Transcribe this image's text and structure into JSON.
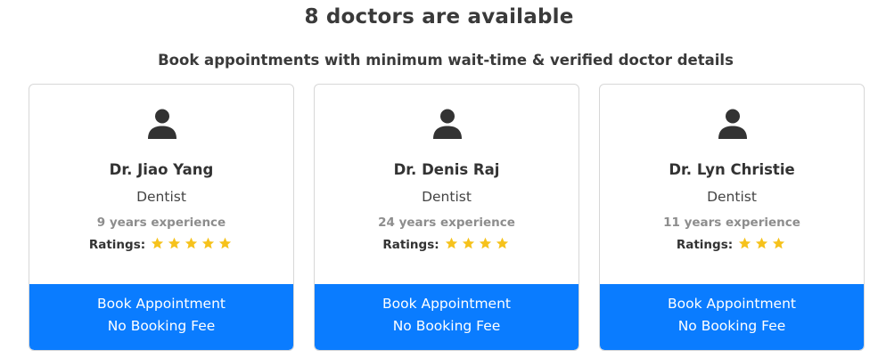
{
  "header": {
    "title": "8 doctors are available",
    "subtitle": "Book appointments with minimum wait-time & verified doctor details"
  },
  "colors": {
    "button": "#0a7cff",
    "star": "#f6c21c",
    "avatar": "#333333"
  },
  "doctors": [
    {
      "name": "Dr. Jiao Yang",
      "specialty": "Dentist",
      "experience": "9 years experience",
      "ratings_label": "Ratings:",
      "rating": 5,
      "button_line1": "Book Appointment",
      "button_line2": "No Booking Fee"
    },
    {
      "name": "Dr. Denis Raj",
      "specialty": "Dentist",
      "experience": "24 years experience",
      "ratings_label": "Ratings:",
      "rating": 4,
      "button_line1": "Book Appointment",
      "button_line2": "No Booking Fee"
    },
    {
      "name": "Dr. Lyn Christie",
      "specialty": "Dentist",
      "experience": "11 years experience",
      "ratings_label": "Ratings:",
      "rating": 3,
      "button_line1": "Book Appointment",
      "button_line2": "No Booking Fee"
    }
  ]
}
